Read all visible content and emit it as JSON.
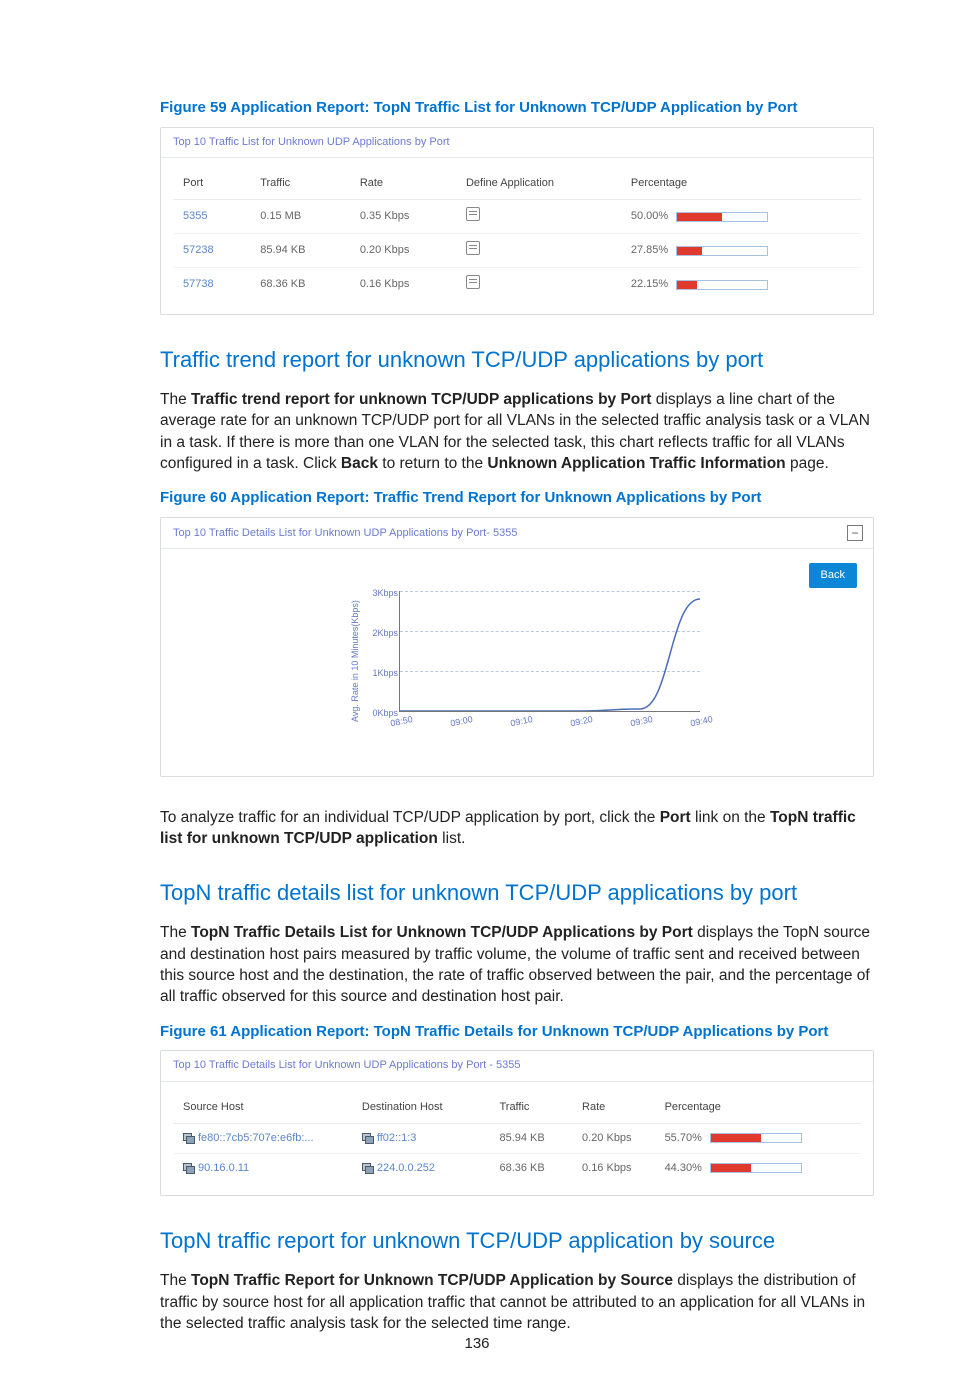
{
  "fig59": {
    "caption": "Figure 59 Application Report: TopN Traffic List for Unknown TCP/UDP Application by Port",
    "panel_title": "Top 10 Traffic List for Unknown UDP Applications by Port",
    "cols": {
      "port": "Port",
      "traffic": "Traffic",
      "rate": "Rate",
      "define": "Define Application",
      "pct": "Percentage"
    },
    "rows": [
      {
        "port": "5355",
        "traffic": "0.15 MB",
        "rate": "0.35 Kbps",
        "pct": "50.00%",
        "pctv": 50.0
      },
      {
        "port": "57238",
        "traffic": "85.94 KB",
        "rate": "0.20 Kbps",
        "pct": "27.85%",
        "pctv": 27.85
      },
      {
        "port": "57738",
        "traffic": "68.36 KB",
        "rate": "0.16 Kbps",
        "pct": "22.15%",
        "pctv": 22.15
      }
    ]
  },
  "sec1_title": "Traffic trend report for unknown TCP/UDP applications by port",
  "sec1_para_parts": [
    "The ",
    "Traffic trend report for unknown TCP/UDP applications by Port",
    " displays a line chart of the average rate for an unknown TCP/UDP port for all VLANs in the selected traffic analysis task or a VLAN in a task. If there is more than one VLAN for the selected task, this chart reflects traffic for all VLANs configured in a task. Click ",
    "Back",
    " to return to the ",
    "Unknown Application Traffic Information",
    " page."
  ],
  "fig60": {
    "caption": "Figure 60 Application Report: Traffic Trend Report for Unknown Applications by Port",
    "panel_title": "Top 10 Traffic Details List for Unknown UDP Applications by Port- 5355",
    "back": "Back",
    "ylabel": "Avg. Rate in 10 Minutes(Kbps)",
    "y_ticks": [
      "3Kbps",
      "2Kbps",
      "1Kbps",
      "0Kbps"
    ],
    "x_ticks": [
      "08:50",
      "09:00",
      "09:10",
      "09:20",
      "09:30",
      "09:40"
    ]
  },
  "chart_data": {
    "type": "line",
    "title": "Top 10 Traffic Details List for Unknown UDP Applications by Port- 5355",
    "xlabel": "",
    "ylabel": "Avg. Rate in 10 Minutes(Kbps)",
    "ylim": [
      0,
      3
    ],
    "x": [
      "08:50",
      "09:00",
      "09:10",
      "09:20",
      "09:30",
      "09:40"
    ],
    "series": [
      {
        "name": "rate",
        "values": [
          0,
          0,
          0,
          0,
          0.05,
          2.8
        ]
      }
    ]
  },
  "mid_para_parts": [
    "To analyze traffic for an individual TCP/UDP application by port, click the ",
    "Port",
    " link on the ",
    "TopN traffic list for unknown TCP/UDP application",
    " list."
  ],
  "sec2_title": "TopN traffic details list for unknown TCP/UDP applications by port",
  "sec2_para_parts": [
    "The ",
    "TopN Traffic Details List for Unknown TCP/UDP Applications by Port",
    " displays the TopN source and destination host pairs measured by traffic volume, the volume of traffic sent and received between this source host and the destination, the rate of traffic observed between the pair, and the percentage of all traffic observed for this source and destination host pair."
  ],
  "fig61": {
    "caption": "Figure 61 Application Report: TopN Traffic Details for Unknown TCP/UDP Applications by Port",
    "panel_title": "Top 10 Traffic Details List for Unknown UDP Applications by Port - 5355",
    "cols": {
      "src": "Source Host",
      "dst": "Destination Host",
      "traffic": "Traffic",
      "rate": "Rate",
      "pct": "Percentage"
    },
    "rows": [
      {
        "src": "fe80::7cb5:707e:e6fb:...",
        "dst": "ff02::1:3",
        "traffic": "85.94 KB",
        "rate": "0.20 Kbps",
        "pct": "55.70%",
        "pctv": 55.7
      },
      {
        "src": "90.16.0.11",
        "dst": "224.0.0.252",
        "traffic": "68.36 KB",
        "rate": "0.16 Kbps",
        "pct": "44.30%",
        "pctv": 44.3
      }
    ]
  },
  "sec3_title": "TopN traffic report for unknown TCP/UDP application by source",
  "sec3_para_parts": [
    "The ",
    "TopN Traffic Report for Unknown TCP/UDP Application by Source",
    " displays the distribution of traffic by source host for all application traffic that cannot be attributed to an application for all VLANs in the selected traffic analysis task for the selected time range."
  ],
  "page_num": "136"
}
